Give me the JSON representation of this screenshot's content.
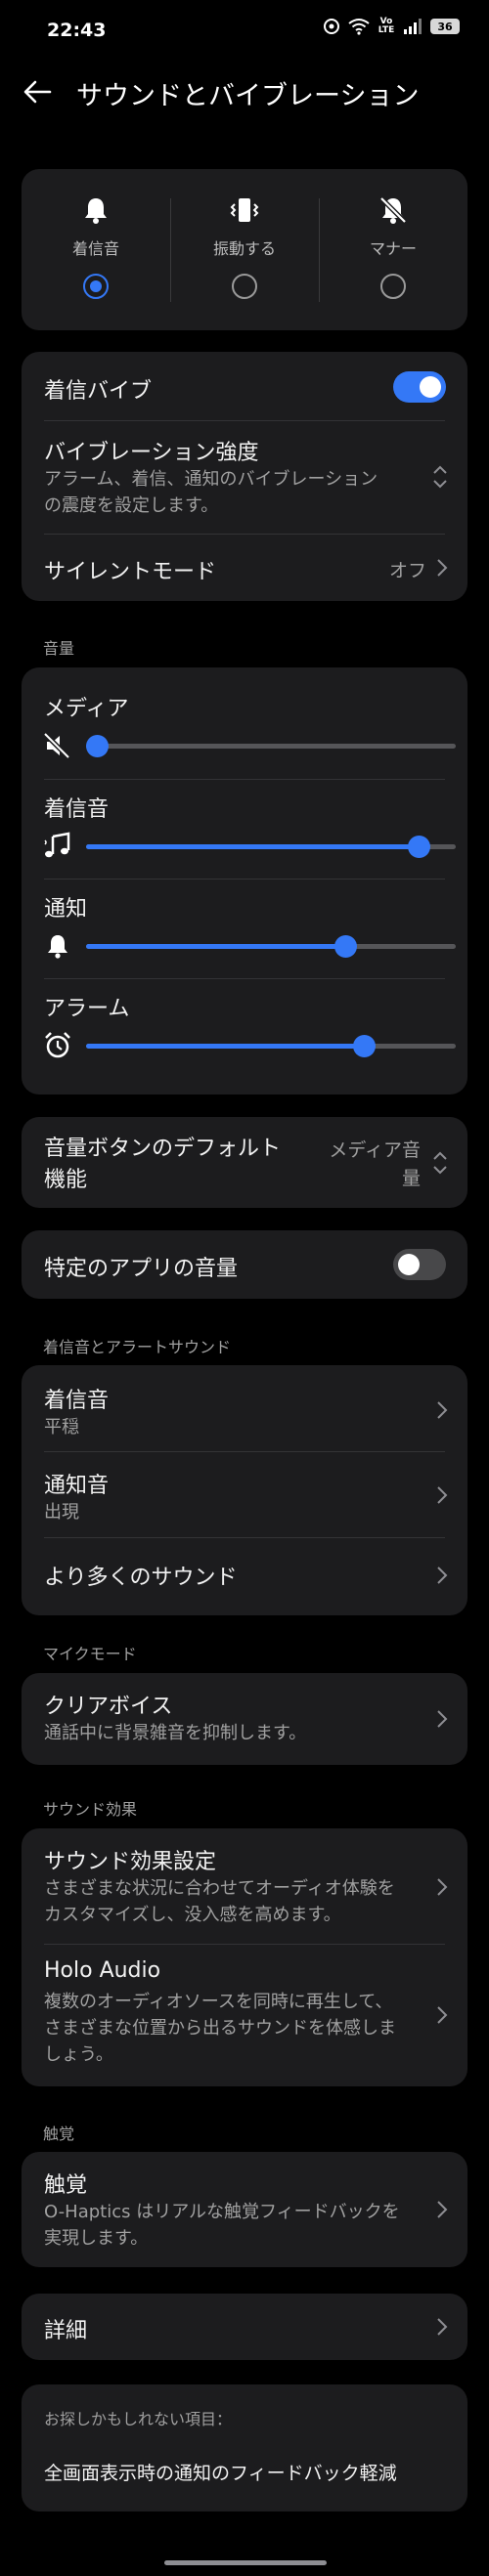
{
  "status": {
    "time": "22:43",
    "battery": "36",
    "network": "Vo LTE"
  },
  "header": {
    "title": "サウンドとバイブレーション"
  },
  "ring_mode": {
    "options": [
      {
        "label": "着信音",
        "icon": "bell-icon",
        "selected": true
      },
      {
        "label": "振動する",
        "icon": "vibrate-icon",
        "selected": false
      },
      {
        "label": "マナー",
        "icon": "bell-off-icon",
        "selected": false
      }
    ]
  },
  "vibration": {
    "ring_vibrate_label": "着信バイブ",
    "ring_vibrate_on": true,
    "intensity_title": "バイブレーション強度",
    "intensity_sub1": "アラーム、着信、通知のバイブレーション",
    "intensity_sub2": "の震度を設定します。",
    "silent_label": "サイレントモード",
    "silent_value": "オフ"
  },
  "volume": {
    "section_label": "音量",
    "items": [
      {
        "label": "メディア",
        "icon": "speaker-muted-icon",
        "level": 0.0
      },
      {
        "label": "着信音",
        "icon": "music-note-icon",
        "level": 0.9
      },
      {
        "label": "通知",
        "icon": "bell-icon",
        "level": 0.7
      },
      {
        "label": "アラーム",
        "icon": "alarm-clock-icon",
        "level": 0.75
      }
    ]
  },
  "volume_button": {
    "title1": "音量ボタンのデフォルト",
    "title2": "機能",
    "value1": "メディア音",
    "value2": "量"
  },
  "app_volume": {
    "label": "特定のアプリの音量",
    "on": false
  },
  "ringtones": {
    "section_label": "着信音とアラートサウンド",
    "items": [
      {
        "title": "着信音",
        "sub": "平穏"
      },
      {
        "title": "通知音",
        "sub": "出現"
      },
      {
        "title": "より多くのサウンド",
        "sub": ""
      }
    ]
  },
  "mic_mode": {
    "section_label": "マイクモード",
    "title": "クリアボイス",
    "sub": "通話中に背景雑音を抑制します。"
  },
  "sound_effects": {
    "section_label": "サウンド効果",
    "settings_title": "サウンド効果設定",
    "settings_sub1": "さまざまな状況に合わせてオーディオ体験を",
    "settings_sub2": "カスタマイズし、没入感を高めます。",
    "holo_title": "Holo Audio",
    "holo_sub1": "複数のオーディオソースを同時に再生して、",
    "holo_sub2": "さまざまな位置から出るサウンドを体感しま",
    "holo_sub3": "しょう。"
  },
  "haptics": {
    "section_label": "触覚",
    "title": "触覚",
    "sub1": "O-Haptics はリアルな触覚フィードバックを",
    "sub2": "実現します。"
  },
  "details": {
    "label": "詳細"
  },
  "suggestions": {
    "heading": "お探しかもしれない項目：",
    "item": "全画面表示時の通知のフィードバック軽減"
  },
  "colors": {
    "accent": "#3478f6",
    "card": "#1c1c1e",
    "background": "#000000"
  }
}
